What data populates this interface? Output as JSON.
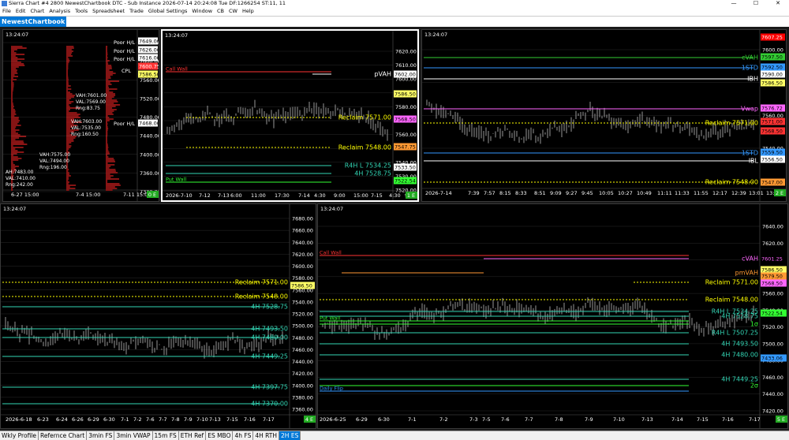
{
  "window": {
    "title": "Sierra Chart #4 2800 NewestChartbook DTC - Sub Instance 2026-07-14  20:24:08 Tue DF:1266254  ST:11, 11",
    "controls": [
      "—",
      "☐",
      "✕"
    ]
  },
  "menu": [
    "File",
    "Edit",
    "Chart",
    "Analysis",
    "Tools",
    "Spreadsheet",
    "Trade",
    "Global Settings",
    "Window",
    "CB",
    "CW",
    "Help"
  ],
  "chartbook_name": "NewestChartbook",
  "colors": {
    "background": "#000000",
    "grid": "#2a2a2a",
    "bar": "#bdbdbd",
    "reclaim": "#ffff00",
    "levels": "#33d6b5",
    "call_wall": "#ff3333",
    "put_wall": "#33ff33",
    "active_border": "#ffffff"
  },
  "charts": [
    {
      "id": "c1",
      "time": "13:24:07",
      "corner_label": "0 E",
      "y_labels": [
        "7640.00",
        "7600.00",
        "7560.00",
        "7520.00",
        "7480.00",
        "7440.00",
        "7400.00",
        "7360.00",
        "7320.00"
      ],
      "x_labels": [
        "6-27  15:00",
        "7-4  15:00",
        "7-11  15:00"
      ],
      "price_tags": [
        {
          "text": "7649.00",
          "bg": "#ffffff",
          "fg": "#000000"
        },
        {
          "text": "7626.00",
          "bg": "#ffffff",
          "fg": "#000000"
        },
        {
          "text": "7616.00",
          "bg": "#ffffff",
          "fg": "#000000"
        },
        {
          "text": "7600.75",
          "bg": "#ff3333",
          "fg": "#ffffff"
        },
        {
          "text": "7586.50",
          "bg": "#ffff66",
          "fg": "#000000"
        },
        {
          "text": "7468.00",
          "bg": "#ffffff",
          "fg": "#000000"
        }
      ],
      "labels": [
        "Poor H/L",
        "Poor H/L",
        "Poor H/L",
        "CPL",
        "Poor H/L"
      ],
      "stats": [
        {
          "lines": [
            "VAH:7601.00",
            "VAL:7569.00",
            "Rng:83.75"
          ]
        },
        {
          "lines": [
            "VAH:7603.00",
            "VAL:7535.00",
            "Rng:160.50"
          ]
        },
        {
          "lines": [
            "VAH:7575.00",
            "VAL:7494.00",
            "Rng:196.00"
          ]
        },
        {
          "lines": [
            "AH:7483.00",
            "VAL:7410.00",
            "Rng:242.00"
          ]
        }
      ]
    },
    {
      "id": "c2",
      "time": "13:24:07",
      "corner_label": "1 E",
      "y_labels": [
        "7620.00",
        "7610.00",
        "7600.00",
        "7590.00",
        "7580.00",
        "7570.00",
        "7560.00",
        "7550.00",
        "7540.00",
        "7530.00",
        "7520.00"
      ],
      "x_labels": [
        "2026-7-10",
        "7-12",
        "7-13",
        "6:00",
        "11:00",
        "17:30",
        "7-14",
        "4:30",
        "9:00",
        "15:00",
        "7-15",
        "4:30",
        "9:00"
      ],
      "price_tags": [
        {
          "text": "7602.00",
          "bg": "#ffffff",
          "fg": "#000000"
        },
        {
          "text": "7586.50",
          "bg": "#ffff66",
          "fg": "#000000"
        },
        {
          "text": "7568.50",
          "bg": "#ff66ff",
          "fg": "#000000"
        },
        {
          "text": "7547.75",
          "bg": "#ff9933",
          "fg": "#000000"
        },
        {
          "text": "7533.50",
          "bg": "#ffffff",
          "fg": "#000000"
        },
        {
          "text": "7522.54",
          "bg": "#33ff33",
          "fg": "#000000"
        }
      ],
      "levels": [
        {
          "text": "Call Wall",
          "color": "#ff3333"
        },
        {
          "text": "pVAH",
          "color": "#ffffff"
        },
        {
          "text": "Reclaim  7571.00",
          "color": "#ffff00"
        },
        {
          "text": "Reclaim  7548.00",
          "color": "#ffff00"
        },
        {
          "text": "R4H L  7534.25",
          "color": "#33d6b5"
        },
        {
          "text": "4H  7528.75",
          "color": "#33d6b5"
        },
        {
          "text": "Put Wall",
          "color": "#33ff33"
        }
      ]
    },
    {
      "id": "c3",
      "time": "13:24:07",
      "corner_label": "2 E",
      "y_labels": [
        "7600.00",
        "7580.00",
        "7560.00",
        "7540.00"
      ],
      "x_labels": [
        "2026-7-14",
        "7:39",
        "7:57",
        "8:15",
        "8:33",
        "8:51",
        "9:09",
        "9:27",
        "9:45",
        "10:05",
        "10:27",
        "10:49",
        "11:11",
        "11:33",
        "11:55",
        "12:17",
        "12:39",
        "13:01",
        "13:23",
        "13:45"
      ],
      "price_tags": [
        {
          "text": "7607.25",
          "bg": "#ff0000",
          "fg": "#ffffff"
        },
        {
          "text": "7597.50",
          "bg": "#33cc33",
          "fg": "#000000"
        },
        {
          "text": "7592.50",
          "bg": "#3399ff",
          "fg": "#000000"
        },
        {
          "text": "7590.00",
          "bg": "#ffffff",
          "fg": "#000000"
        },
        {
          "text": "7586.50",
          "bg": "#ffff66",
          "fg": "#000000"
        },
        {
          "text": "7576.72",
          "bg": "#ff66ff",
          "fg": "#000000"
        },
        {
          "text": "7571.00",
          "bg": "#ff3333",
          "fg": "#000000"
        },
        {
          "text": "7568.50",
          "bg": "#ff3333",
          "fg": "#000000"
        },
        {
          "text": "7559.50",
          "bg": "#3399ff",
          "fg": "#000000"
        },
        {
          "text": "7556.50",
          "bg": "#ffffff",
          "fg": "#000000"
        },
        {
          "text": "7547.00",
          "bg": "#ff9933",
          "fg": "#000000"
        }
      ],
      "levels": [
        {
          "text": "cVAH",
          "color": "#33cc33"
        },
        {
          "text": "1STD",
          "color": "#3399ff"
        },
        {
          "text": "IBH",
          "color": "#ffffff"
        },
        {
          "text": "Vwap",
          "color": "#ff66ff"
        },
        {
          "text": "Reclaim  7571.00",
          "color": "#ffff00"
        },
        {
          "text": "1STD",
          "color": "#3399ff"
        },
        {
          "text": "IBL",
          "color": "#ffffff"
        },
        {
          "text": "Reclaim  7548.00",
          "color": "#ffff00"
        }
      ]
    },
    {
      "id": "c4",
      "time": "13:24:07",
      "corner_label": "4 E",
      "y_labels": [
        "7680.00",
        "7660.00",
        "7640.00",
        "7620.00",
        "7600.00",
        "7580.00",
        "7560.00",
        "7540.00",
        "7520.00",
        "7500.00",
        "7480.00",
        "7460.00",
        "7440.00",
        "7420.00",
        "7400.00",
        "7380.00",
        "7360.00"
      ],
      "x_labels": [
        "2026-6-18",
        "6-23",
        "6-24",
        "6-26",
        "6-29",
        "6-30",
        "7-1",
        "7-2",
        "7-6",
        "7-7",
        "7-8",
        "7-9",
        "7-10",
        "7-13",
        "7-15",
        "7-16",
        "7-17"
      ],
      "price_tags": [
        {
          "text": "7586.50",
          "bg": "#ffff66",
          "fg": "#000000"
        }
      ],
      "levels": [
        {
          "text": "Reclaim  7571.00",
          "color": "#ffff00"
        },
        {
          "text": "Reclaim  7548.00",
          "color": "#ffff00"
        },
        {
          "text": "4H  7528.75",
          "color": "#33d6b5"
        },
        {
          "text": "4H  7493.50",
          "color": "#33d6b5"
        },
        {
          "text": "4H  7480.00",
          "color": "#33d6b5"
        },
        {
          "text": "4H  7449.25",
          "color": "#33d6b5"
        },
        {
          "text": "4H  7397.75",
          "color": "#33d6b5"
        },
        {
          "text": "4H  7370.00",
          "color": "#33d6b5"
        }
      ]
    },
    {
      "id": "c5",
      "time": "13:24:07",
      "corner_label": "5 E",
      "y_labels": [
        "7640.00",
        "7620.00",
        "7600.00",
        "7580.00",
        "7560.00",
        "7540.00",
        "7520.00",
        "7500.00",
        "7480.00",
        "7460.00",
        "7440.00",
        "7420.00"
      ],
      "x_labels": [
        "2026-6-25",
        "6-29",
        "6-30",
        "7-1",
        "7-2",
        "7-3",
        "7-5",
        "7-6",
        "7-7",
        "7-8",
        "7-9",
        "7-10",
        "7-13",
        "7-14",
        "7-15",
        "7-16",
        "7-17"
      ],
      "price_tags": [
        {
          "text": "7601.25",
          "bg": "#000000",
          "fg": "#ff66ff"
        },
        {
          "text": "7586.50",
          "bg": "#ffff66",
          "fg": "#000000"
        },
        {
          "text": "7579.50",
          "bg": "#ff9933",
          "fg": "#000000"
        },
        {
          "text": "7568.50",
          "bg": "#ff66ff",
          "fg": "#000000"
        },
        {
          "text": "7522.54",
          "bg": "#33ff33",
          "fg": "#000000"
        },
        {
          "text": "7433.06",
          "bg": "#3399ff",
          "fg": "#000000"
        }
      ],
      "levels": [
        {
          "text": "Call Wall",
          "color": "#ff3333"
        },
        {
          "text": "cVAH",
          "color": "#ff66ff"
        },
        {
          "text": "pmVAH",
          "color": "#ff9933"
        },
        {
          "text": "Reclaim  7571.00",
          "color": "#ffff00"
        },
        {
          "text": "Reclaim  7548.00",
          "color": "#ffff00"
        },
        {
          "text": "R4H L  7534.25",
          "color": "#33d6b5"
        },
        {
          "text": "4H  7528.75",
          "color": "#33d6b5"
        },
        {
          "text": "Put Wall",
          "color": "#33ff33"
        },
        {
          "text": "1σ",
          "color": "#33ff33"
        },
        {
          "text": "R4H L  7507.25",
          "color": "#33d6b5"
        },
        {
          "text": "4H  7493.50",
          "color": "#33d6b5"
        },
        {
          "text": "4H  7480.00",
          "color": "#33d6b5"
        },
        {
          "text": "4H  7449.25",
          "color": "#33d6b5"
        },
        {
          "text": "2σ",
          "color": "#33ff33"
        },
        {
          "text": "Daily Flip",
          "color": "#3399ff"
        }
      ]
    }
  ],
  "tabs": [
    "Wkly Profile",
    "Refernce Chart",
    "3min FS",
    "3min VWAP",
    "15m FS",
    "ETH Ref",
    "ES MBO",
    "4h FS",
    "4H RTH",
    "2H ES"
  ],
  "selected_tab": "2H ES"
}
